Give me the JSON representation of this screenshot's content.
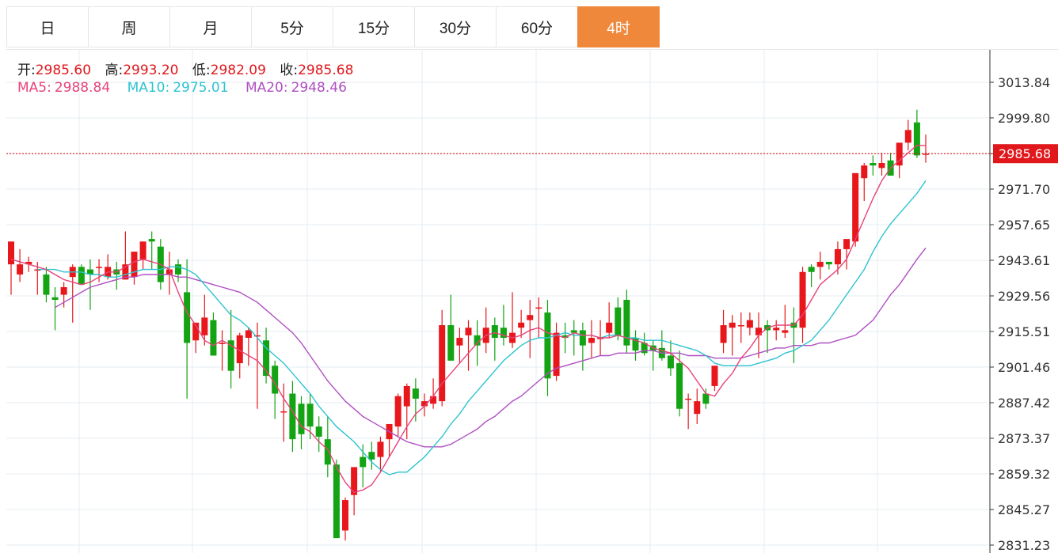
{
  "tabs": [
    {
      "label": "日",
      "active": false
    },
    {
      "label": "周",
      "active": false
    },
    {
      "label": "月",
      "active": false
    },
    {
      "label": "5分",
      "active": false
    },
    {
      "label": "15分",
      "active": false
    },
    {
      "label": "30分",
      "active": false
    },
    {
      "label": "60分",
      "active": false
    },
    {
      "label": "4时",
      "active": true
    }
  ],
  "ohlc_info": {
    "open_label": "开:",
    "open": "2985.60",
    "high_label": "高:",
    "high": "2993.20",
    "low_label": "低:",
    "low": "2982.09",
    "close_label": "收:",
    "close": "2985.68"
  },
  "ma_info": {
    "ma5_label": "MA5:",
    "ma5": "2988.84",
    "ma10_label": "MA10:",
    "ma10": "2975.01",
    "ma20_label": "MA20:",
    "ma20": "2948.46"
  },
  "colors": {
    "up": "#e8171b",
    "down": "#13a313",
    "ma5": "#e8427a",
    "ma10": "#2ec3d1",
    "ma20": "#b04fc2",
    "accent": "#f0883c",
    "grid": "#e6ecf2",
    "last_price": "#e0171b"
  },
  "chart_data": {
    "type": "candlestick",
    "y_ticks": [
      "3013.84",
      "2999.80",
      "2985.68",
      "2971.70",
      "2957.65",
      "2943.61",
      "2929.56",
      "2915.51",
      "2901.46",
      "2887.42",
      "2873.37",
      "2859.32",
      "2845.27",
      "2831.23"
    ],
    "ylim": [
      2831.23,
      3013.84
    ],
    "grid": true,
    "last_price": "2985.68",
    "candles": [
      [
        2942,
        2951,
        2930,
        2951
      ],
      [
        2938,
        2948,
        2935,
        2942
      ],
      [
        2942,
        2945,
        2939,
        2943
      ],
      [
        2940,
        2943,
        2930,
        2940
      ],
      [
        2938,
        2941,
        2927,
        2930
      ],
      [
        2929,
        2933,
        2916,
        2928
      ],
      [
        2930,
        2935,
        2925,
        2933
      ],
      [
        2937,
        2942,
        2919,
        2941
      ],
      [
        2941,
        2942,
        2935,
        2934
      ],
      [
        2940,
        2944,
        2924,
        2938
      ],
      [
        2941,
        2944,
        2935,
        2941
      ],
      [
        2937,
        2946,
        2936,
        2941
      ],
      [
        2940,
        2943,
        2932,
        2938
      ],
      [
        2936,
        2955,
        2936,
        2942
      ],
      [
        2937,
        2947,
        2934,
        2947
      ],
      [
        2944,
        2951,
        2940,
        2951
      ],
      [
        2952,
        2955,
        2940,
        2951
      ],
      [
        2949,
        2952,
        2932,
        2935
      ],
      [
        2938,
        2947,
        2930,
        2940
      ],
      [
        2942,
        2944,
        2935,
        2938
      ],
      [
        2931,
        2944,
        2889,
        2911
      ],
      [
        2912,
        2916,
        2907,
        2919
      ],
      [
        2914,
        2930,
        2910,
        2921
      ],
      [
        2920,
        2923,
        2906,
        2906
      ],
      [
        2911,
        2916,
        2900,
        2911
      ],
      [
        2912,
        2924,
        2893,
        2900
      ],
      [
        2903,
        2915,
        2897,
        2914
      ],
      [
        2913,
        2917,
        2902,
        2916
      ],
      [
        2914,
        2919,
        2885,
        2914
      ],
      [
        2912,
        2917,
        2895,
        2898
      ],
      [
        2902,
        2904,
        2881,
        2891
      ],
      [
        2884,
        2895,
        2872,
        2884
      ],
      [
        2891,
        2896,
        2868,
        2873
      ],
      [
        2887,
        2890,
        2869,
        2875
      ],
      [
        2887,
        2891,
        2873,
        2878
      ],
      [
        2878,
        2882,
        2868,
        2874
      ],
      [
        2873,
        2882,
        2858,
        2863
      ],
      [
        2863,
        2865,
        2834,
        2834
      ],
      [
        2837,
        2850,
        2833,
        2849
      ],
      [
        2851,
        2862,
        2843,
        2862
      ],
      [
        2866,
        2871,
        2854,
        2862
      ],
      [
        2868,
        2872,
        2861,
        2865
      ],
      [
        2866,
        2874,
        2860,
        2872
      ],
      [
        2873,
        2879,
        2866,
        2879
      ],
      [
        2878,
        2891,
        2874,
        2890
      ],
      [
        2886,
        2895,
        2873,
        2894
      ],
      [
        2893,
        2897,
        2880,
        2889
      ],
      [
        2886,
        2891,
        2882,
        2888
      ],
      [
        2887,
        2897,
        2885,
        2890
      ],
      [
        2888,
        2924,
        2886,
        2918
      ],
      [
        2918,
        2930,
        2906,
        2904
      ],
      [
        2910,
        2917,
        2903,
        2913
      ],
      [
        2914,
        2920,
        2900,
        2917
      ],
      [
        2914,
        2920,
        2902,
        2910
      ],
      [
        2911,
        2925,
        2907,
        2917
      ],
      [
        2918,
        2921,
        2904,
        2913
      ],
      [
        2917,
        2926,
        2910,
        2913
      ],
      [
        2911,
        2931,
        2909,
        2915
      ],
      [
        2917,
        2924,
        2913,
        2919
      ],
      [
        2920,
        2928,
        2905,
        2922
      ],
      [
        2925,
        2929,
        2913,
        2925
      ],
      [
        2923,
        2928,
        2890,
        2897
      ],
      [
        2898,
        2919,
        2896,
        2915
      ],
      [
        2914,
        2919,
        2907,
        2913
      ],
      [
        2916,
        2920,
        2906,
        2915
      ],
      [
        2916,
        2919,
        2900,
        2910
      ],
      [
        2911,
        2920,
        2905,
        2913
      ],
      [
        2913,
        2920,
        2906,
        2913
      ],
      [
        2915,
        2927,
        2913,
        2919
      ],
      [
        2925,
        2929,
        2912,
        2914
      ],
      [
        2928,
        2932,
        2907,
        2910
      ],
      [
        2913,
        2916,
        2904,
        2908
      ],
      [
        2911,
        2915,
        2906,
        2907
      ],
      [
        2910,
        2912,
        2900,
        2908
      ],
      [
        2909,
        2916,
        2904,
        2905
      ],
      [
        2906,
        2912,
        2898,
        2901
      ],
      [
        2903,
        2908,
        2882,
        2885
      ],
      [
        2889,
        2891,
        2877,
        2889
      ],
      [
        2883,
        2893,
        2879,
        2888
      ],
      [
        2891,
        2893,
        2885,
        2887
      ],
      [
        2894,
        2901,
        2892,
        2902
      ],
      [
        2911,
        2924,
        2907,
        2918
      ],
      [
        2917,
        2922,
        2906,
        2919
      ],
      [
        2918,
        2923,
        2911,
        2918
      ],
      [
        2917,
        2923,
        2914,
        2920
      ],
      [
        2914,
        2923,
        2905,
        2917
      ],
      [
        2918,
        2920,
        2907,
        2916
      ],
      [
        2916,
        2920,
        2912,
        2917
      ],
      [
        2915,
        2926,
        2913,
        2916
      ],
      [
        2919,
        2925,
        2903,
        2917
      ],
      [
        2917,
        2941,
        2911,
        2939
      ],
      [
        2941,
        2942,
        2933,
        2939
      ],
      [
        2941,
        2947,
        2936,
        2943
      ],
      [
        2943,
        2943,
        2940,
        2942
      ],
      [
        2942,
        2951,
        2938,
        2948
      ],
      [
        2948,
        2949,
        2940,
        2952
      ],
      [
        2951,
        2967,
        2949,
        2978
      ],
      [
        2976,
        2982,
        2967,
        2981
      ],
      [
        2982,
        2985,
        2977,
        2981
      ],
      [
        2980,
        2986,
        2977,
        2982
      ],
      [
        2983,
        2986,
        2977,
        2977
      ],
      [
        2981,
        2984,
        2976,
        2990
      ],
      [
        2990,
        2999,
        2987,
        2995
      ],
      [
        2998,
        3003,
        2984,
        2985
      ],
      [
        2985.6,
        2993.2,
        2982.09,
        2985.68
      ]
    ],
    "ma5": [
      2944,
      2943,
      2942,
      2941,
      2940,
      2938,
      2936,
      2935,
      2934,
      2935,
      2937,
      2939,
      2939,
      2941,
      2943,
      2944,
      2943,
      2942,
      2940,
      2931,
      2923,
      2918,
      2912,
      2910,
      2912,
      2910,
      2908,
      2906,
      2904,
      2900,
      2895,
      2889,
      2884,
      2878,
      2876,
      2872,
      2869,
      2862,
      2856,
      2852,
      2853,
      2855,
      2860,
      2866,
      2872,
      2878,
      2883,
      2886,
      2890,
      2895,
      2899,
      2903,
      2907,
      2911,
      2914,
      2915,
      2914,
      2913,
      2914,
      2916,
      2917,
      2915,
      2914,
      2913,
      2915,
      2914,
      2914,
      2913,
      2913,
      2914,
      2913,
      2912,
      2911,
      2909,
      2908,
      2907,
      2904,
      2901,
      2896,
      2891,
      2890,
      2895,
      2899,
      2905,
      2909,
      2914,
      2917,
      2918,
      2918,
      2918,
      2922,
      2928,
      2934,
      2937,
      2940,
      2944,
      2952,
      2960,
      2968,
      2975,
      2980,
      2983,
      2986,
      2989,
      2988.84
    ],
    "ma10": [
      2940,
      2940,
      2940,
      2939,
      2939,
      2939,
      2938,
      2938,
      2937,
      2937,
      2938,
      2939,
      2940,
      2940,
      2940,
      2941,
      2941,
      2940,
      2938,
      2934,
      2930,
      2926,
      2922,
      2920,
      2917,
      2913,
      2909,
      2906,
      2903,
      2899,
      2895,
      2891,
      2886,
      2882,
      2878,
      2875,
      2872,
      2868,
      2864,
      2861,
      2859,
      2860,
      2860,
      2863,
      2866,
      2870,
      2874,
      2879,
      2883,
      2888,
      2892,
      2896,
      2900,
      2904,
      2907,
      2910,
      2912,
      2913,
      2913,
      2914,
      2915,
      2914,
      2914,
      2914,
      2913,
      2914,
      2914,
      2913,
      2913,
      2912,
      2912,
      2912,
      2911,
      2910,
      2909,
      2908,
      2906,
      2903,
      2902,
      2902,
      2902,
      2902,
      2903,
      2904,
      2905,
      2907,
      2908,
      2910,
      2912,
      2916,
      2920,
      2925,
      2930,
      2935,
      2940,
      2947,
      2953,
      2958,
      2962,
      2966,
      2970,
      2975.01
    ],
    "ma20": [
      2925,
      2927,
      2929,
      2931,
      2933,
      2934,
      2935,
      2936,
      2937,
      2937,
      2938,
      2938,
      2938,
      2938,
      2937,
      2937,
      2936,
      2935,
      2934,
      2933,
      2932,
      2931,
      2929,
      2927,
      2924,
      2921,
      2918,
      2915,
      2911,
      2906,
      2901,
      2896,
      2892,
      2888,
      2885,
      2882,
      2880,
      2878,
      2876,
      2874,
      2872,
      2871,
      2870,
      2870,
      2870,
      2871,
      2873,
      2875,
      2877,
      2880,
      2882,
      2885,
      2888,
      2890,
      2893,
      2896,
      2899,
      2901,
      2902,
      2903,
      2904,
      2905,
      2906,
      2906,
      2907,
      2907,
      2907,
      2908,
      2908,
      2907,
      2907,
      2907,
      2906,
      2906,
      2906,
      2905,
      2905,
      2905,
      2905,
      2906,
      2907,
      2908,
      2909,
      2909,
      2910,
      2910,
      2910,
      2911,
      2911,
      2912,
      2913,
      2914,
      2917,
      2920,
      2925,
      2930,
      2934,
      2939,
      2944,
      2948.46
    ]
  }
}
